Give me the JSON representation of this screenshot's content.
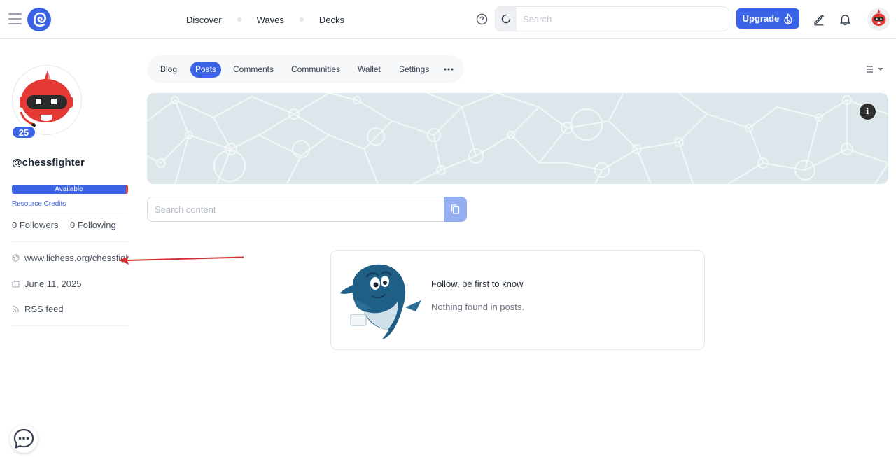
{
  "header": {
    "nav": [
      {
        "label": "Discover"
      },
      {
        "label": "Waves"
      },
      {
        "label": "Decks"
      }
    ],
    "search": {
      "placeholder": "Search",
      "value": ""
    },
    "upgrade_label": "Upgrade",
    "icons": {
      "menu": "hamburger-icon",
      "logo": "ecency-logo-icon",
      "help": "question-circle-icon",
      "search_prefix": "spinner-icon",
      "upgrade": "flame-icon",
      "compose": "pencil-icon",
      "notifications": "bell-icon",
      "avatar": "robot-avatar"
    }
  },
  "profile": {
    "reputation": "25",
    "username": "@chessfighter",
    "resource_credits_status": "Available",
    "resource_credits_label": "Resource Credits",
    "followers": "0 Followers",
    "following": "0 Following",
    "website": "www.lichess.org/chessfighter",
    "joined": "June 11, 2025",
    "rss": "RSS feed",
    "icons": {
      "website": "globe-icon",
      "joined": "calendar-icon",
      "rss": "rss-icon"
    }
  },
  "tabs": [
    {
      "label": "Blog",
      "active": false
    },
    {
      "label": "Posts",
      "active": true
    },
    {
      "label": "Comments",
      "active": false
    },
    {
      "label": "Communities",
      "active": false
    },
    {
      "label": "Wallet",
      "active": false
    },
    {
      "label": "Settings",
      "active": false
    }
  ],
  "cover": {
    "info_label": "i"
  },
  "content_search": {
    "placeholder": "Search content",
    "value": ""
  },
  "empty_state": {
    "title": "Follow, be first to know",
    "subtitle": "Nothing found in posts."
  },
  "colors": {
    "accent": "#3a63e6",
    "cover_bg": "#dde6ea",
    "annotation_arrow": "#d32f2f",
    "rc_warning": "#e53935"
  }
}
